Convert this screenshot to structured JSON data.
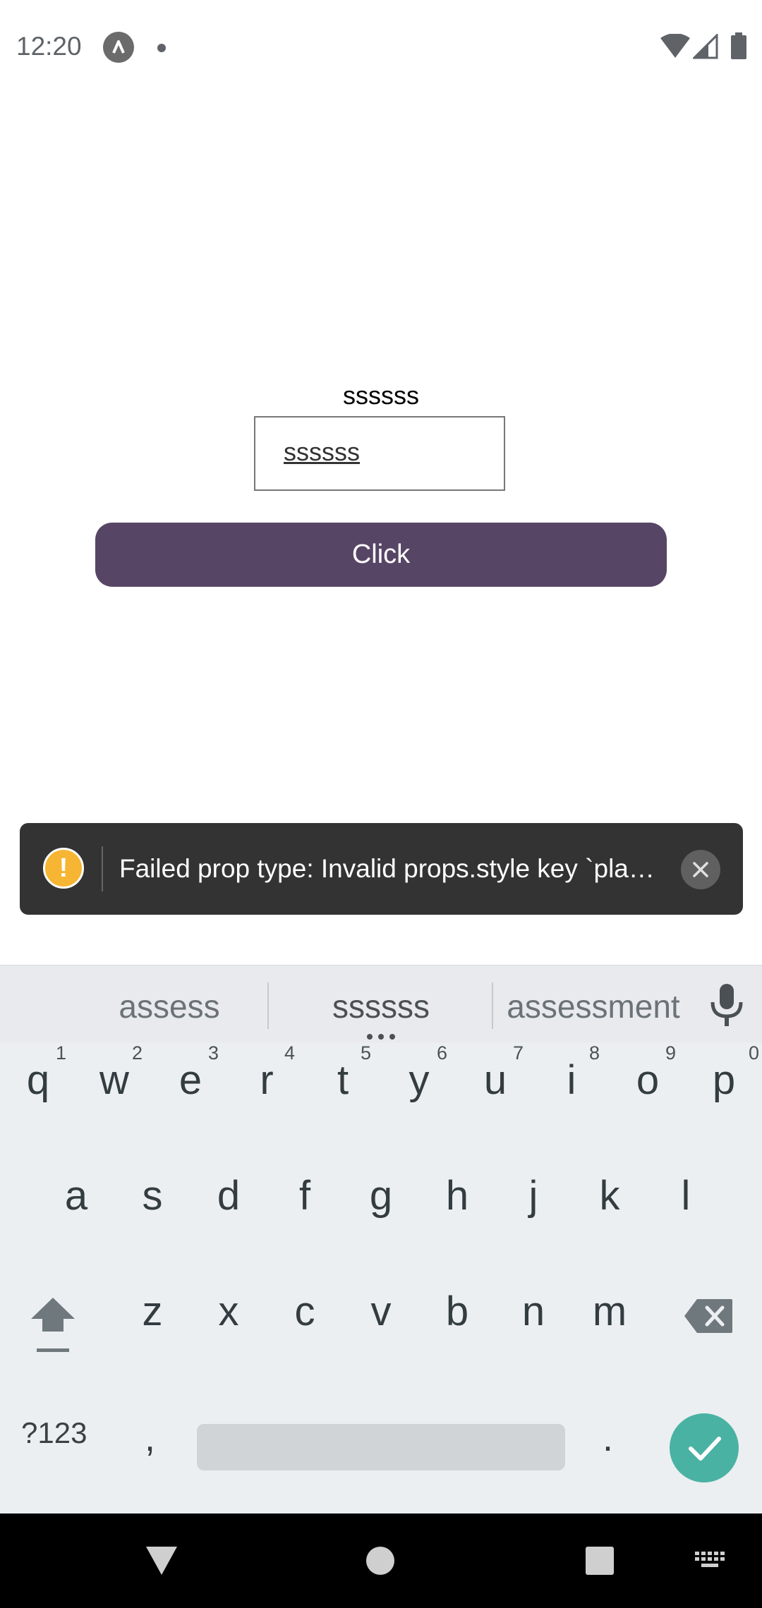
{
  "status_bar": {
    "time": "12:20"
  },
  "content": {
    "display_text": "ssssss",
    "input_value": "ssssss",
    "button_label": "Click"
  },
  "toast": {
    "message": "Failed prop type: Invalid props.style key `pla…"
  },
  "keyboard": {
    "suggestions": [
      "assess",
      "ssssss",
      "assessment"
    ],
    "row1": [
      {
        "key": "q",
        "hint": "1"
      },
      {
        "key": "w",
        "hint": "2"
      },
      {
        "key": "e",
        "hint": "3"
      },
      {
        "key": "r",
        "hint": "4"
      },
      {
        "key": "t",
        "hint": "5"
      },
      {
        "key": "y",
        "hint": "6"
      },
      {
        "key": "u",
        "hint": "7"
      },
      {
        "key": "i",
        "hint": "8"
      },
      {
        "key": "o",
        "hint": "9"
      },
      {
        "key": "p",
        "hint": "0"
      }
    ],
    "row2": [
      "a",
      "s",
      "d",
      "f",
      "g",
      "h",
      "j",
      "k",
      "l"
    ],
    "row3": [
      "z",
      "x",
      "c",
      "v",
      "b",
      "n",
      "m"
    ],
    "symbols_label": "?123",
    "comma": ",",
    "period": "."
  },
  "colors": {
    "button": "#574566",
    "toast_bg": "#333333",
    "warning": "#f6b532",
    "enter": "#49b2a3"
  },
  "icons": [
    "app-icon",
    "wifi-icon",
    "signal-icon",
    "battery-icon",
    "warning-icon",
    "close-icon",
    "mic-icon",
    "shift-icon",
    "backspace-icon",
    "check-icon",
    "back-icon",
    "home-icon",
    "recents-icon",
    "keyboard-icon"
  ]
}
